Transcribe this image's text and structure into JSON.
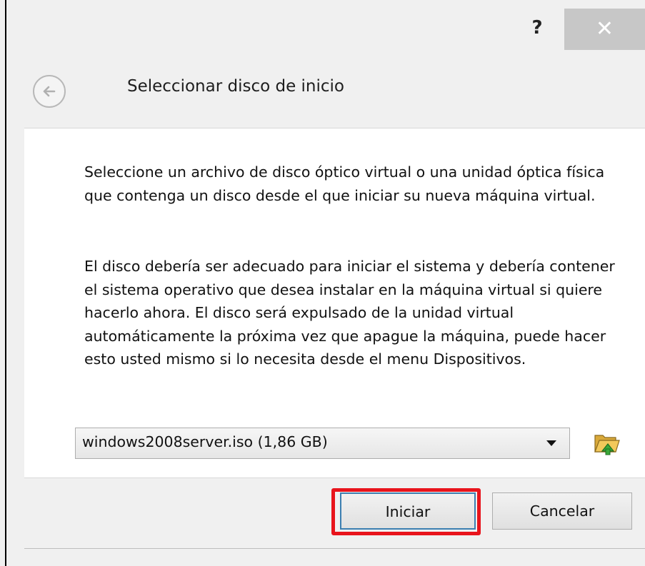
{
  "titlebar": {
    "help_label": "?",
    "close_label": "✕"
  },
  "header": {
    "title": "Seleccionar disco de inicio",
    "back_icon": "back-arrow-icon"
  },
  "content": {
    "paragraph1": "Seleccione un archivo de disco óptico virtual o una unidad óptica física que contenga un disco desde el que iniciar su nueva máquina virtual.",
    "paragraph2": "El disco debería ser adecuado para iniciar el sistema y debería contener el sistema operativo que desea instalar en la máquina virtual si quiere hacerlo ahora. El disco será expulsado de la unidad virtual automáticamente la próxima vez que apague la máquina, puede hacer esto usted mismo si lo necesita desde el menu Dispositivos.",
    "disk_select": {
      "value": "windows2008server.iso (1,86 GB)"
    },
    "folder_icon": "folder-open-icon"
  },
  "footer": {
    "start_label": "Iniciar",
    "cancel_label": "Cancelar"
  },
  "colors": {
    "highlight": "#e8141c",
    "close_bg": "#c7c7c7",
    "default_button_border": "#3c7fb1"
  }
}
